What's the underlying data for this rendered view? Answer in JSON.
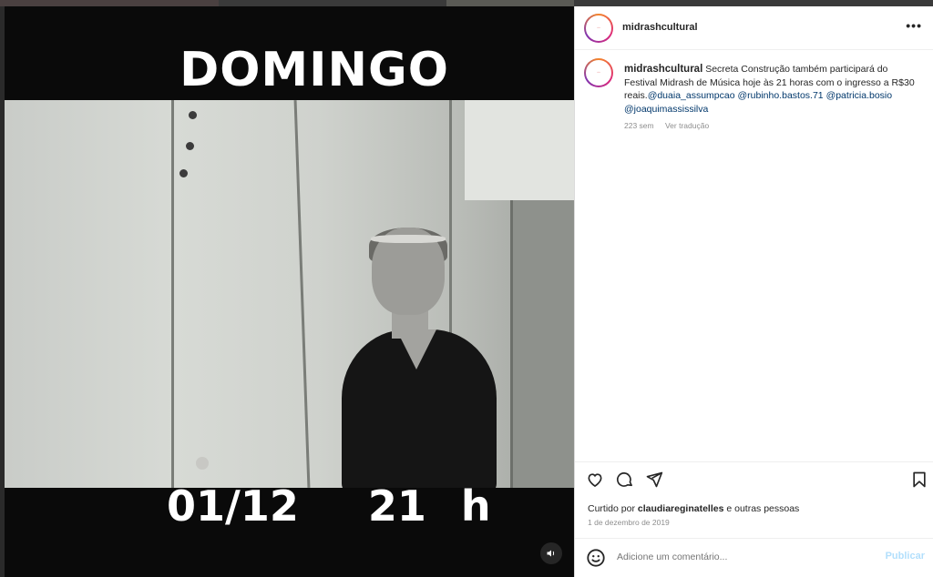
{
  "post": {
    "media": {
      "top_text": "DOMINGO",
      "bottom_text": "01/12  21 h",
      "sound_icon": "speaker-icon"
    },
    "header": {
      "username": "midrashcultural",
      "more_icon": "more-icon",
      "more_label": "•••"
    },
    "caption": {
      "username": "midrashcultural",
      "text": "Secreta Construção também participará do Festival Midrash de Música hoje às 21 horas com o ingresso a R$30 reais.",
      "mentions": [
        "@duaia_assumpcao",
        "@rubinho.bastos.71",
        "@patricia.bosio",
        "@joaquimassissilva"
      ],
      "age": "223 sem",
      "translate": "Ver tradução"
    },
    "actions": {
      "like_icon": "heart-icon",
      "comment_icon": "comment-icon",
      "share_icon": "send-icon",
      "save_icon": "bookmark-icon"
    },
    "likes": {
      "prefix": "Curtido por",
      "user": "claudiareginatelles",
      "suffix": "e outras pessoas"
    },
    "date": "1 de dezembro de 2019",
    "comment": {
      "placeholder": "Adicione um comentário...",
      "publish": "Publicar",
      "emoji_icon": "emoji-icon"
    },
    "colors": {
      "link": "#00376b",
      "muted": "#8e8e8e",
      "publish_disabled": "#b2dffc",
      "text": "#262626"
    }
  }
}
